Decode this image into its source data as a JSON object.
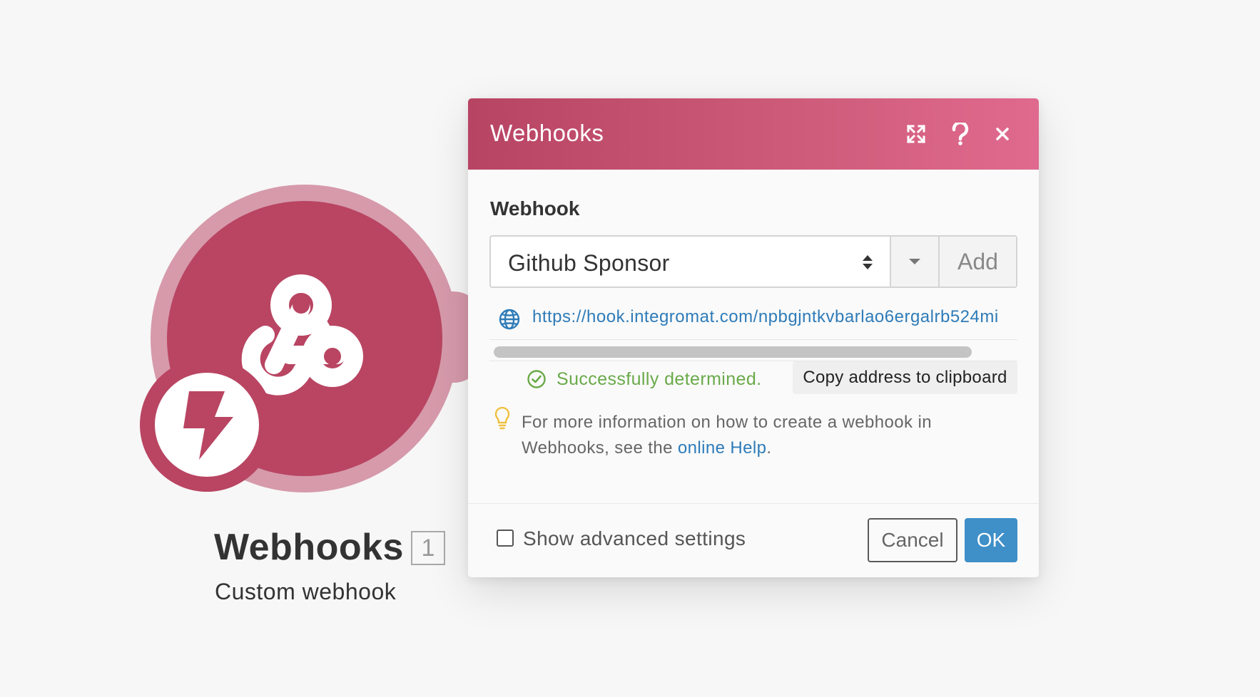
{
  "module": {
    "title": "Webhooks",
    "count": "1",
    "subtitle": "Custom webhook",
    "main_icon": "webhook-icon",
    "badge_icon": "lightning-bolt-icon"
  },
  "dialog": {
    "title": "Webhooks",
    "header_icons": [
      "expand-icon",
      "help-icon",
      "close-icon"
    ],
    "field_label": "Webhook",
    "select": {
      "value": "Github Sponsor",
      "add_label": "Add"
    },
    "url": "https://hook.integromat.com/npbgjntkvbarlao6ergalrb524mi",
    "status_text": "Successfully determined.",
    "copy_label": "Copy address to clipboard",
    "info": {
      "text_before": "For more information on how to create a webhook in Webhooks, see the ",
      "link_text": "online Help",
      "text_after": "."
    },
    "footer": {
      "advanced_label": "Show advanced settings",
      "cancel_label": "Cancel",
      "ok_label": "OK"
    }
  },
  "colors": {
    "brand": "#b94562",
    "brand_light": "#d69aab",
    "header_gradient_end": "#e06a8e",
    "link": "#2e7bb8",
    "success": "#6aaa4a",
    "primary_button": "#3f8fc8",
    "hint": "#f0c040"
  }
}
